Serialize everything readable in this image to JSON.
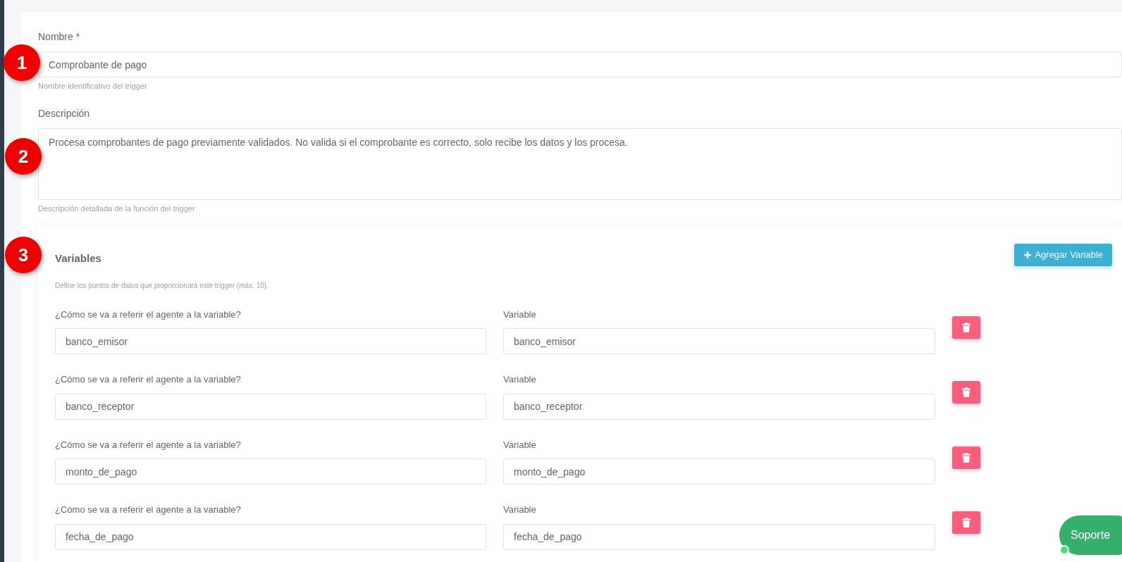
{
  "name_field": {
    "label": "Nombre *",
    "value": "Comprobante de pago",
    "hint": "Nombre identificativo del trigger"
  },
  "description_field": {
    "label": "Descripción",
    "value": "Procesa comprobantes de pago previamente validados. No valida si el comprobante es correcto, solo recibe los datos y los procesa.",
    "hint": "Descripción detallada de la función del trigger"
  },
  "variables": {
    "title": "Variables",
    "add_button": "Agregar Variable",
    "description": "Define los puntos de datos que proporcionará este trigger (máx. 10).",
    "rows": [
      {
        "alias_label": "¿Cómo se va a referir el agente a la variable?",
        "alias": "banco_emisor",
        "variable_label": "Variable",
        "variable": "banco_emisor"
      },
      {
        "alias_label": "¿Cómo se va a referir el agente a la variable?",
        "alias": "banco_receptor",
        "variable_label": "Variable",
        "variable": "banco_receptor"
      },
      {
        "alias_label": "¿Cómo se va a referir el agente a la variable?",
        "alias": "monto_de_pago",
        "variable_label": "Variable",
        "variable": "monto_de_pago"
      },
      {
        "alias_label": "¿Cómo se va a referir el agente a la variable?",
        "alias": "fecha_de_pago",
        "variable_label": "Variable",
        "variable": "fecha_de_pago"
      }
    ]
  },
  "markers": [
    "1",
    "2",
    "3"
  ],
  "support_button": {
    "label": "Soporte",
    "online": true
  }
}
